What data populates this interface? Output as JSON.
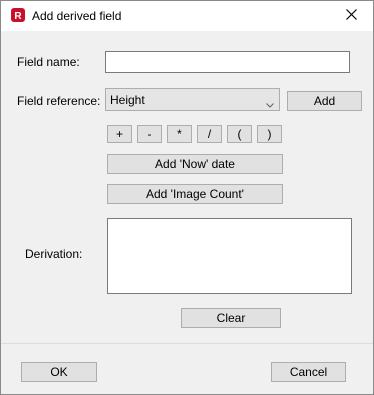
{
  "dialog": {
    "title": "Add derived field",
    "icons": {
      "app": "app-logo-icon",
      "close": "close-icon"
    }
  },
  "form": {
    "field_name_label": "Field name:",
    "field_name_value": "",
    "field_reference_label": "Field reference:",
    "field_reference_selected": "Height",
    "add_label": "Add",
    "operators": [
      "+",
      "-",
      "*",
      "/",
      "(",
      ")"
    ],
    "add_now_date_label": "Add 'Now' date",
    "add_image_count_label": "Add 'Image Count'",
    "derivation_label": "Derivation:",
    "derivation_value": "",
    "clear_label": "Clear"
  },
  "footer": {
    "ok_label": "OK",
    "cancel_label": "Cancel"
  }
}
